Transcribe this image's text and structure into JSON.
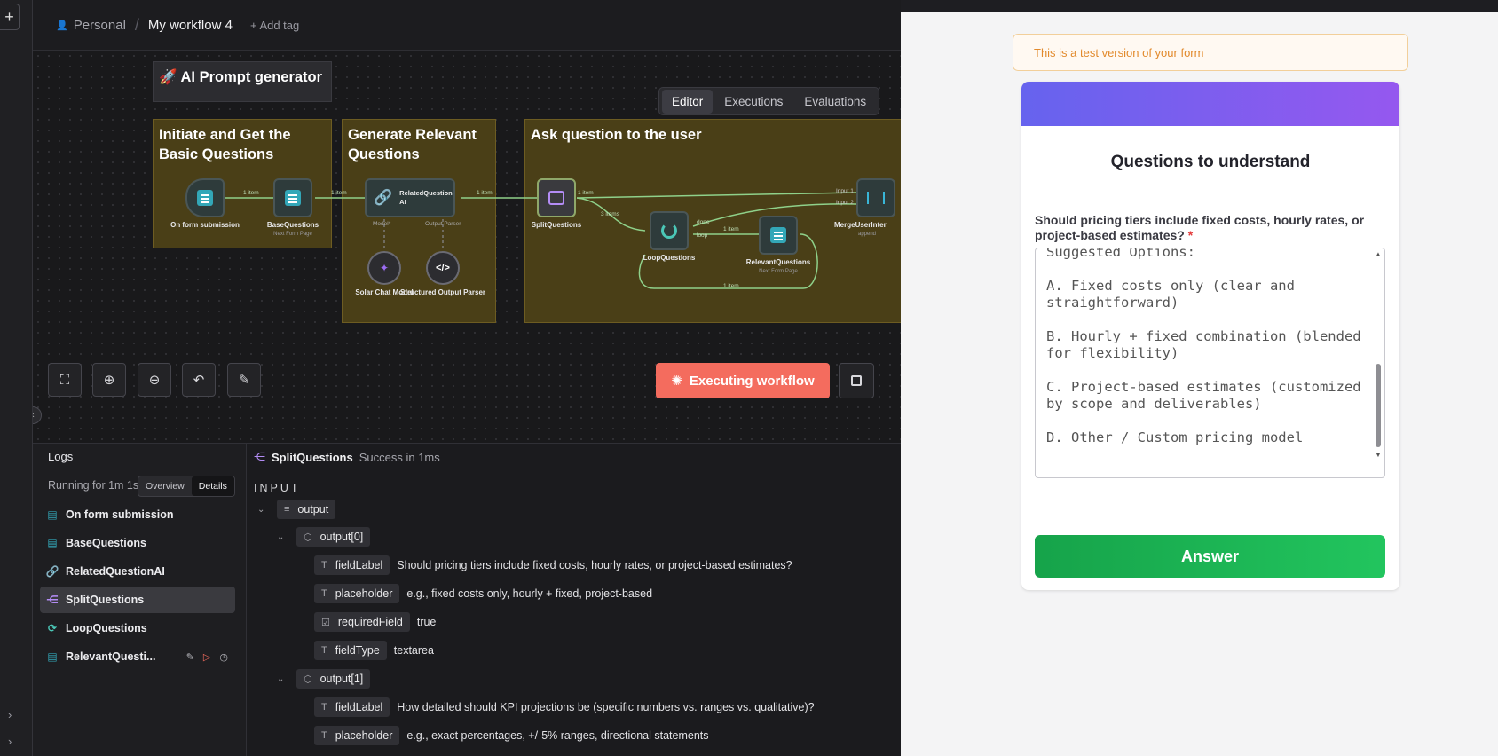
{
  "header": {
    "project": "Personal",
    "workflow_name": "My workflow 4",
    "add_tag": "+ Add tag"
  },
  "tabs": [
    "Editor",
    "Executions",
    "Evaluations"
  ],
  "stickies": {
    "title": "🚀 AI Prompt generator",
    "group1": "Initiate and Get the Basic Questions",
    "group2": "Generate Relevant Questions",
    "group3": "Ask question to the user"
  },
  "nodes": {
    "on_form": "On form submission",
    "base": "BaseQuestions",
    "base_sub": "Next Form Page",
    "related": "RelatedQuestion AI",
    "split": "SplitQuestions",
    "loop": "LoopQuestions",
    "relevant": "RelevantQuestions",
    "relevant_sub": "Next Form Page",
    "merge": "MergeUserInter",
    "merge_sub": "append",
    "solar": "Solar Chat Model",
    "parser": "Structured Output Parser",
    "edge_1item_a": "1 item",
    "edge_1item_b": "1 item",
    "edge_1item_c": "1 item",
    "edge_1item_d": "1 item",
    "edge_3items": "3 items",
    "edge_1item_e": "1 item",
    "edge_1item_f": "1 item",
    "edge_model": "Model*",
    "edge_parser": "Output Parser",
    "edge_done": "done",
    "edge_loop": "loop",
    "edge_input1": "Input 1",
    "edge_input2": "Input 2"
  },
  "toolbar": {
    "execute_label": "Executing workflow"
  },
  "logs": {
    "title": "Logs",
    "running": "Running for 1m 1s",
    "seg_overview": "Overview",
    "seg_details": "Details",
    "items": [
      "On form submission",
      "BaseQuestions",
      "RelatedQuestionAI",
      "SplitQuestions",
      "LoopQuestions",
      "RelevantQuesti..."
    ]
  },
  "output_panel": {
    "node_name": "SplitQuestions",
    "status": "Success in 1ms",
    "section": "INPUT",
    "root": "output",
    "item0": "output[0]",
    "item1": "output[1]",
    "rows": [
      {
        "key": "fieldLabel",
        "value": "Should pricing tiers include fixed costs, hourly rates, or project-based estimates?"
      },
      {
        "key": "placeholder",
        "value": "e.g., fixed costs only, hourly + fixed, project-based"
      },
      {
        "key": "requiredField",
        "value": "true"
      },
      {
        "key": "fieldType",
        "value": "textarea"
      },
      {
        "key": "fieldLabel",
        "value": "How detailed should KPI projections be (specific numbers vs. ranges vs. qualitative)?"
      },
      {
        "key": "placeholder",
        "value": "e.g., exact percentages, +/-5% ranges, directional statements"
      }
    ]
  },
  "form": {
    "notice": "This is a test version of your form",
    "title": "Questions to understand",
    "question": "Should pricing tiers include fixed costs, hourly rates, or project-based estimates?",
    "required_mark": "*",
    "textarea": "Suggested Options:\n\nA. Fixed costs only (clear and straightforward)\n\nB. Hourly + fixed combination (blended for flexibility)\n\nC. Project-based estimates (customized by scope and deliverables)\n\nD. Other / Custom pricing model",
    "submit": "Answer"
  }
}
